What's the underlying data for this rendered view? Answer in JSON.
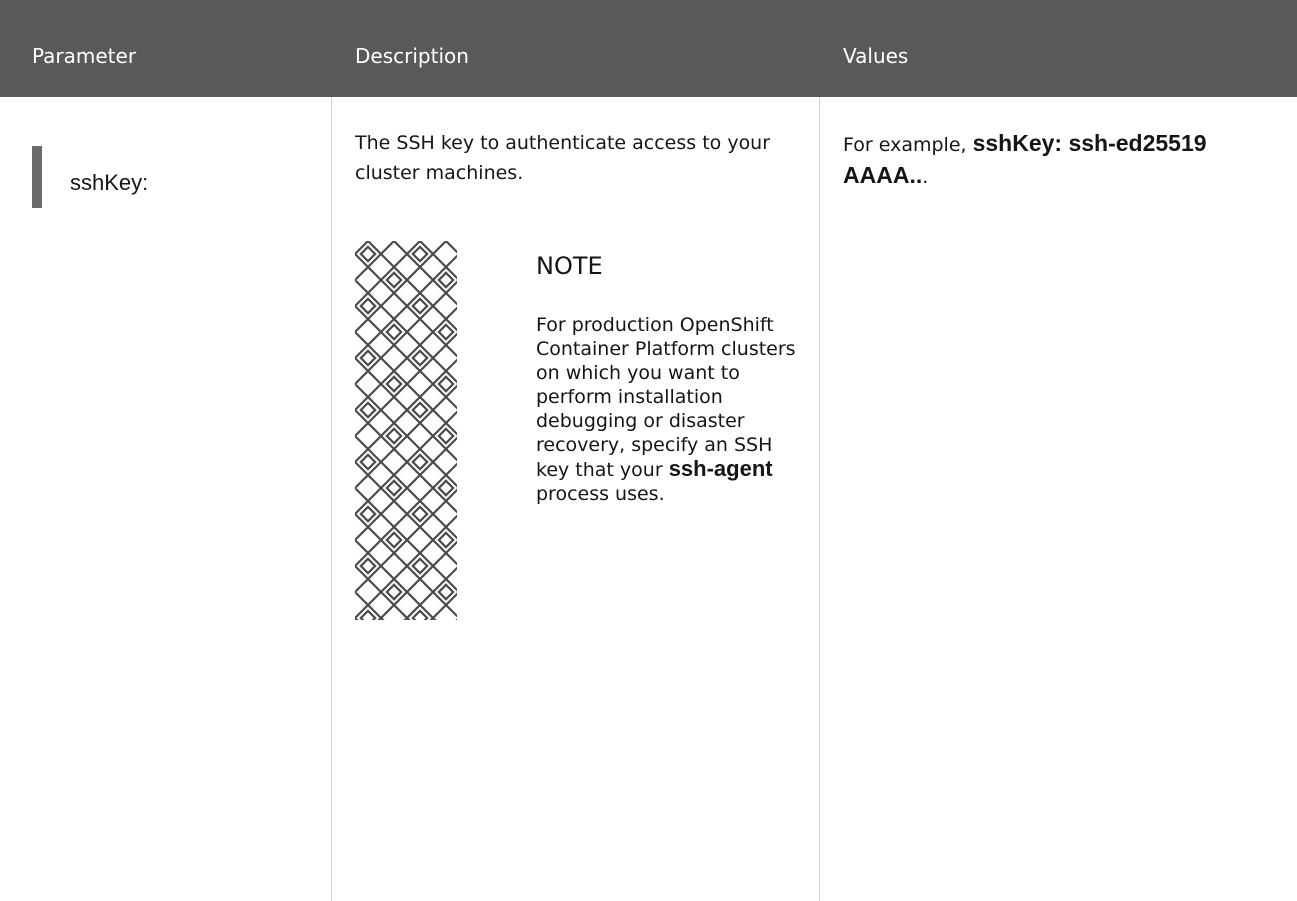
{
  "table": {
    "headers": {
      "parameter": "Parameter",
      "description": "Description",
      "values": "Values"
    },
    "row": {
      "parameter": "sshKey:",
      "description": "The SSH key to authenticate access to your cluster machines.",
      "values": {
        "prefix": "For example, ",
        "code": "sshKey: ssh-ed25519 AAAA..",
        "suffix": "."
      }
    }
  },
  "note": {
    "title": "NOTE",
    "body_before": "For production OpenShift Container Platform clusters on which you want to perform installation debugging or disaster recovery, specify an SSH key that your ",
    "body_code": "ssh-agent",
    "body_after": " process uses.",
    "icon": "note-pattern-icon"
  },
  "colors": {
    "header_bg": "#595959",
    "header_text": "#ffffff",
    "accent_bar": "#6a6a6a",
    "divider": "#d2d2d2"
  }
}
